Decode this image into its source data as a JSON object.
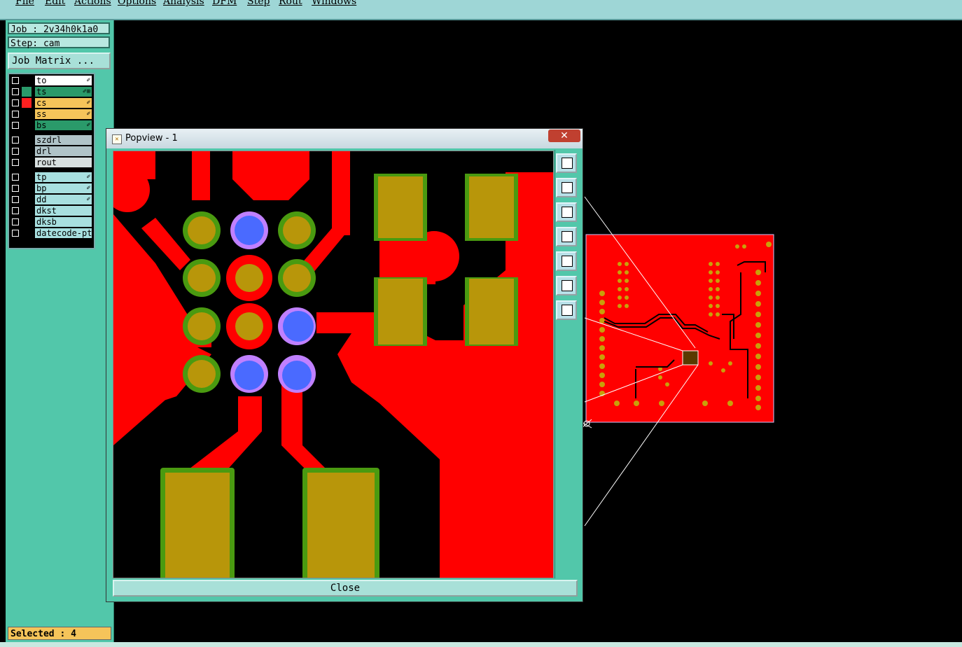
{
  "menu": [
    "File",
    "Edit",
    "Actions",
    "Options",
    "Analysis",
    "DFM",
    "Step",
    "Rout",
    "Windows"
  ],
  "job_label": "Job : 2v34h0k1a0",
  "step_label": "Step: cam",
  "job_matrix_label": "Job Matrix ...",
  "layers": [
    {
      "name": "to",
      "bg": "#ffffff",
      "color": "#000000",
      "mark": "✐"
    },
    {
      "name": "ts",
      "bg": "#2a9a6a",
      "color": "#2a9a6a",
      "mark": "✐⊞"
    },
    {
      "name": "cs",
      "bg": "#f5c45a",
      "color": "#ff2020",
      "mark": "✐"
    },
    {
      "name": "ss",
      "bg": "#f5c45a",
      "color": "#000000",
      "mark": "✐"
    },
    {
      "name": "bs",
      "bg": "#2a9a6a",
      "color": "#000000",
      "mark": "✐"
    },
    {
      "name": "szdrl",
      "bg": "#b0c4c8",
      "color": "#000000",
      "mark": ""
    },
    {
      "name": "drl",
      "bg": "#b0c4c8",
      "color": "#000000",
      "mark": ""
    },
    {
      "name": "rout",
      "bg": "#d8e0e0",
      "color": "#000000",
      "mark": ""
    },
    {
      "name": "tp",
      "bg": "#a8e0e0",
      "color": "#000000",
      "mark": "✐"
    },
    {
      "name": "bp",
      "bg": "#a8e0e0",
      "color": "#000000",
      "mark": "✐"
    },
    {
      "name": "dd",
      "bg": "#a8e0e0",
      "color": "#000000",
      "mark": "✐"
    },
    {
      "name": "dkst",
      "bg": "#a8e0e0",
      "color": "#000000",
      "mark": ""
    },
    {
      "name": "dksb",
      "bg": "#a8e0e0",
      "color": "#000000",
      "mark": ""
    },
    {
      "name": "datecode-pt",
      "bg": "#a8e0e0",
      "color": "#000000",
      "mark": ""
    }
  ],
  "selected_label": "Selected : 4",
  "popview": {
    "title": "Popview - 1",
    "close_x": "✕",
    "close_label": "Close"
  },
  "colors": {
    "copper": "#ff0000",
    "pad": "#b8960a",
    "mask": "#4a9a10",
    "via": "#4a6aff",
    "via_ring": "#c080ff"
  }
}
